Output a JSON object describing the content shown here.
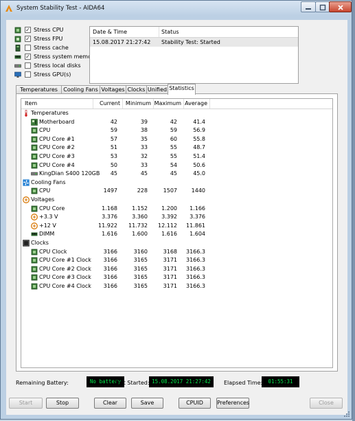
{
  "window": {
    "title": "System Stability Test - AIDA64"
  },
  "stress_options": [
    {
      "label": "Stress CPU",
      "checked": true,
      "icon": "cpu-chip-icon"
    },
    {
      "label": "Stress FPU",
      "checked": true,
      "icon": "fpu-chip-icon"
    },
    {
      "label": "Stress cache",
      "checked": false,
      "icon": "cache-chip-icon"
    },
    {
      "label": "Stress system memory",
      "checked": true,
      "icon": "memory-module-icon"
    },
    {
      "label": "Stress local disks",
      "checked": false,
      "icon": "disk-drive-icon"
    },
    {
      "label": "Stress GPU(s)",
      "checked": false,
      "icon": "monitor-icon"
    }
  ],
  "log": {
    "columns": [
      "Date & Time",
      "Status"
    ],
    "rows": [
      {
        "datetime": "15.08.2017 21:27:42",
        "status": "Stability Test: Started"
      }
    ]
  },
  "tabs": [
    {
      "label": "Temperatures",
      "active": false
    },
    {
      "label": "Cooling Fans",
      "active": false
    },
    {
      "label": "Voltages",
      "active": false
    },
    {
      "label": "Clocks",
      "active": false
    },
    {
      "label": "Unified",
      "active": false
    },
    {
      "label": "Statistics",
      "active": true
    }
  ],
  "stats": {
    "columns": [
      "Item",
      "Current",
      "Minimum",
      "Maximum",
      "Average"
    ],
    "rows": [
      {
        "type": "group",
        "name": "Temperatures",
        "icon": "thermometer-icon"
      },
      {
        "type": "item",
        "name": "Motherboard",
        "icon": "motherboard-icon",
        "cur": "42",
        "min": "39",
        "max": "42",
        "avg": "41.4"
      },
      {
        "type": "item",
        "name": "CPU",
        "icon": "cpu-chip-icon",
        "cur": "59",
        "min": "38",
        "max": "59",
        "avg": "56.9"
      },
      {
        "type": "item",
        "name": "CPU Core #1",
        "icon": "cpu-chip-icon",
        "cur": "57",
        "min": "35",
        "max": "60",
        "avg": "55.8"
      },
      {
        "type": "item",
        "name": "CPU Core #2",
        "icon": "cpu-chip-icon",
        "cur": "51",
        "min": "33",
        "max": "55",
        "avg": "48.7"
      },
      {
        "type": "item",
        "name": "CPU Core #3",
        "icon": "cpu-chip-icon",
        "cur": "53",
        "min": "32",
        "max": "55",
        "avg": "51.4"
      },
      {
        "type": "item",
        "name": "CPU Core #4",
        "icon": "cpu-chip-icon",
        "cur": "50",
        "min": "33",
        "max": "54",
        "avg": "50.6"
      },
      {
        "type": "item",
        "name": "KingDian S400 120GB",
        "icon": "disk-drive-icon",
        "cur": "45",
        "min": "45",
        "max": "45",
        "avg": "45.0"
      },
      {
        "type": "group",
        "name": "Cooling Fans",
        "icon": "fan-icon"
      },
      {
        "type": "item",
        "name": "CPU",
        "icon": "cpu-chip-icon",
        "cur": "1497",
        "min": "228",
        "max": "1507",
        "avg": "1440"
      },
      {
        "type": "group",
        "name": "Voltages",
        "icon": "voltage-icon"
      },
      {
        "type": "item",
        "name": "CPU Core",
        "icon": "cpu-chip-icon",
        "cur": "1.168",
        "min": "1.152",
        "max": "1.200",
        "avg": "1.166"
      },
      {
        "type": "item",
        "name": "+3.3 V",
        "icon": "voltage-icon",
        "cur": "3.376",
        "min": "3.360",
        "max": "3.392",
        "avg": "3.376"
      },
      {
        "type": "item",
        "name": "+12 V",
        "icon": "voltage-icon",
        "cur": "11.922",
        "min": "11.732",
        "max": "12.112",
        "avg": "11.861"
      },
      {
        "type": "item",
        "name": "DIMM",
        "icon": "memory-module-icon",
        "cur": "1.616",
        "min": "1.600",
        "max": "1.616",
        "avg": "1.604"
      },
      {
        "type": "group",
        "name": "Clocks",
        "icon": "clock-icon"
      },
      {
        "type": "item",
        "name": "CPU Clock",
        "icon": "cpu-chip-icon",
        "cur": "3166",
        "min": "3160",
        "max": "3168",
        "avg": "3166.3"
      },
      {
        "type": "item",
        "name": "CPU Core #1 Clock",
        "icon": "cpu-chip-icon",
        "cur": "3166",
        "min": "3165",
        "max": "3171",
        "avg": "3166.3"
      },
      {
        "type": "item",
        "name": "CPU Core #2 Clock",
        "icon": "cpu-chip-icon",
        "cur": "3166",
        "min": "3165",
        "max": "3171",
        "avg": "3166.3"
      },
      {
        "type": "item",
        "name": "CPU Core #3 Clock",
        "icon": "cpu-chip-icon",
        "cur": "3166",
        "min": "3165",
        "max": "3171",
        "avg": "3166.3"
      },
      {
        "type": "item",
        "name": "CPU Core #4 Clock",
        "icon": "cpu-chip-icon",
        "cur": "3166",
        "min": "3165",
        "max": "3171",
        "avg": "3166.3"
      }
    ]
  },
  "status": {
    "battery_label": "Remaining Battery:",
    "battery_value": "No battery",
    "started_label": "Test Started:",
    "started_value": "15.08.2017 21:27:42",
    "elapsed_label": "Elapsed Time:",
    "elapsed_value": "01:55:31"
  },
  "buttons": {
    "start": "Start",
    "stop": "Stop",
    "clear": "Clear",
    "save": "Save",
    "cpuid": "CPUID",
    "preferences": "Preferences",
    "close": "Close"
  },
  "colors": {
    "lcd_text": "#00e84a",
    "lcd_bg": "#000000",
    "chip_green": "#3e7d3b"
  }
}
